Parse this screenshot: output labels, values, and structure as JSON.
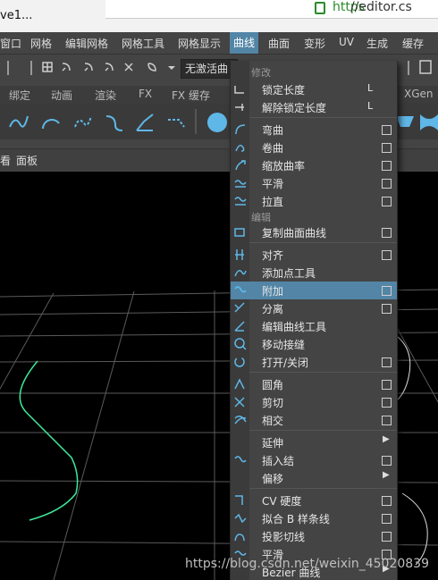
{
  "browser": {
    "tab_title": "ve1...",
    "url_segment": "https",
    "url_text": "//editor.cs"
  },
  "menubar": {
    "items": [
      "窗口",
      "网格",
      "编辑网格",
      "网格工具",
      "网格显示",
      "曲线",
      "曲面",
      "变形",
      "UV",
      "生成",
      "缓存"
    ],
    "active": "曲线"
  },
  "toolbar": {
    "select_value": "无激活曲"
  },
  "shelf_tabs": [
    "绑定",
    "动画",
    "渲染",
    "FX",
    "FX 缓存",
    "XGen"
  ],
  "panelbar": {
    "left_label": "面板",
    "left_fragment": "看"
  },
  "dropdown": {
    "section_modify": "修改",
    "lock_length": "锁定长度",
    "lock_length_shortcut": "L",
    "unlock_length": "解除锁定长度",
    "unlock_length_shortcut": "L",
    "bend": "弯曲",
    "curl": "卷曲",
    "scale_curvature": "缩放曲率",
    "smooth": "平滑",
    "straighten": "拉直",
    "section_edit": "编辑",
    "duplicate_surface_curves": "复制曲面曲线",
    "align": "对齐",
    "add_points_tool": "添加点工具",
    "attach": "附加",
    "detach": "分离",
    "edit_curve_tool": "编辑曲线工具",
    "move_seam": "移动接缝",
    "open_close": "打开/关闭",
    "fillet": "圆角",
    "cut": "剪切",
    "intersect": "相交",
    "extend": "延伸",
    "insert_knot": "插入结",
    "offset": "偏移",
    "cv_hardness": "CV 硬度",
    "fit_bspline": "拟合 B 样条线",
    "project_tangent": "投影切线",
    "smooth2": "平滑",
    "bezier_curves": "Bezier 曲线"
  },
  "watermark": "https://blog.csdn.net/weixin_45020839",
  "colors": {
    "accent": "#5285a6",
    "curve": "#3de89a",
    "background": "#444444"
  }
}
